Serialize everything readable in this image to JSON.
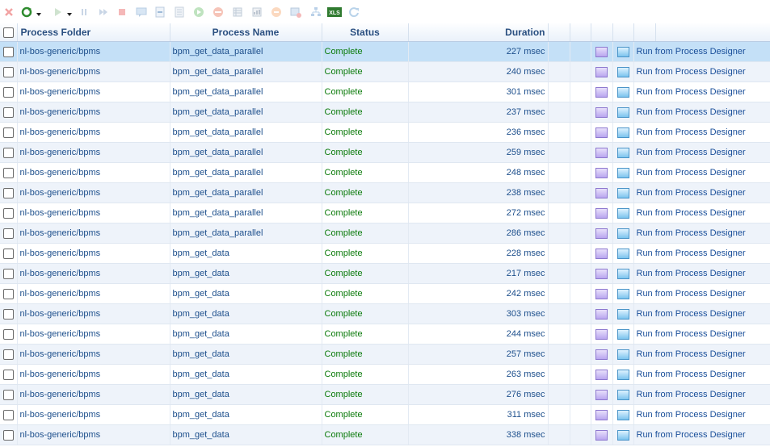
{
  "toolbar": {
    "icons": [
      "close-icon",
      "refresh-icon",
      "dropdown-icon",
      "run-icon",
      "dropdown-icon",
      "pause-icon",
      "resume-icon",
      "stop-icon",
      "comment-icon",
      "export-icon",
      "document-icon",
      "play-green-icon",
      "no-entry-icon",
      "grid-icon",
      "report-icon",
      "alert-icon",
      "image-icon",
      "tree-icon",
      "xls-icon",
      "reload-icon"
    ],
    "xls_label": "XLS",
    "colors": {
      "refresh": "#2e8b2e",
      "xls": "#2f7a2f",
      "disabled": "#c8c8c8"
    }
  },
  "grid": {
    "columns": {
      "folder": "Process Folder",
      "name": "Process Name",
      "status": "Status",
      "duration": "Duration"
    },
    "rows": [
      {
        "folder": "nl-bos-generic/bpms",
        "name": "bpm_get_data_parallel",
        "status": "Complete",
        "duration": "227 msec",
        "action": "Run from Process Designer"
      },
      {
        "folder": "nl-bos-generic/bpms",
        "name": "bpm_get_data_parallel",
        "status": "Complete",
        "duration": "240 msec",
        "action": "Run from Process Designer"
      },
      {
        "folder": "nl-bos-generic/bpms",
        "name": "bpm_get_data_parallel",
        "status": "Complete",
        "duration": "301 msec",
        "action": "Run from Process Designer"
      },
      {
        "folder": "nl-bos-generic/bpms",
        "name": "bpm_get_data_parallel",
        "status": "Complete",
        "duration": "237 msec",
        "action": "Run from Process Designer"
      },
      {
        "folder": "nl-bos-generic/bpms",
        "name": "bpm_get_data_parallel",
        "status": "Complete",
        "duration": "236 msec",
        "action": "Run from Process Designer"
      },
      {
        "folder": "nl-bos-generic/bpms",
        "name": "bpm_get_data_parallel",
        "status": "Complete",
        "duration": "259 msec",
        "action": "Run from Process Designer"
      },
      {
        "folder": "nl-bos-generic/bpms",
        "name": "bpm_get_data_parallel",
        "status": "Complete",
        "duration": "248 msec",
        "action": "Run from Process Designer"
      },
      {
        "folder": "nl-bos-generic/bpms",
        "name": "bpm_get_data_parallel",
        "status": "Complete",
        "duration": "238 msec",
        "action": "Run from Process Designer"
      },
      {
        "folder": "nl-bos-generic/bpms",
        "name": "bpm_get_data_parallel",
        "status": "Complete",
        "duration": "272 msec",
        "action": "Run from Process Designer"
      },
      {
        "folder": "nl-bos-generic/bpms",
        "name": "bpm_get_data_parallel",
        "status": "Complete",
        "duration": "286 msec",
        "action": "Run from Process Designer"
      },
      {
        "folder": "nl-bos-generic/bpms",
        "name": "bpm_get_data",
        "status": "Complete",
        "duration": "228 msec",
        "action": "Run from Process Designer"
      },
      {
        "folder": "nl-bos-generic/bpms",
        "name": "bpm_get_data",
        "status": "Complete",
        "duration": "217 msec",
        "action": "Run from Process Designer"
      },
      {
        "folder": "nl-bos-generic/bpms",
        "name": "bpm_get_data",
        "status": "Complete",
        "duration": "242 msec",
        "action": "Run from Process Designer"
      },
      {
        "folder": "nl-bos-generic/bpms",
        "name": "bpm_get_data",
        "status": "Complete",
        "duration": "303 msec",
        "action": "Run from Process Designer"
      },
      {
        "folder": "nl-bos-generic/bpms",
        "name": "bpm_get_data",
        "status": "Complete",
        "duration": "244 msec",
        "action": "Run from Process Designer"
      },
      {
        "folder": "nl-bos-generic/bpms",
        "name": "bpm_get_data",
        "status": "Complete",
        "duration": "257 msec",
        "action": "Run from Process Designer"
      },
      {
        "folder": "nl-bos-generic/bpms",
        "name": "bpm_get_data",
        "status": "Complete",
        "duration": "263 msec",
        "action": "Run from Process Designer"
      },
      {
        "folder": "nl-bos-generic/bpms",
        "name": "bpm_get_data",
        "status": "Complete",
        "duration": "276 msec",
        "action": "Run from Process Designer"
      },
      {
        "folder": "nl-bos-generic/bpms",
        "name": "bpm_get_data",
        "status": "Complete",
        "duration": "311 msec",
        "action": "Run from Process Designer"
      },
      {
        "folder": "nl-bos-generic/bpms",
        "name": "bpm_get_data",
        "status": "Complete",
        "duration": "338 msec",
        "action": "Run from Process Designer"
      }
    ],
    "selected_row": 0,
    "colors": {
      "status_complete": "#0a7a0a",
      "selected_row": "#c4e0f7",
      "alt_row": "#eef3fa"
    }
  }
}
